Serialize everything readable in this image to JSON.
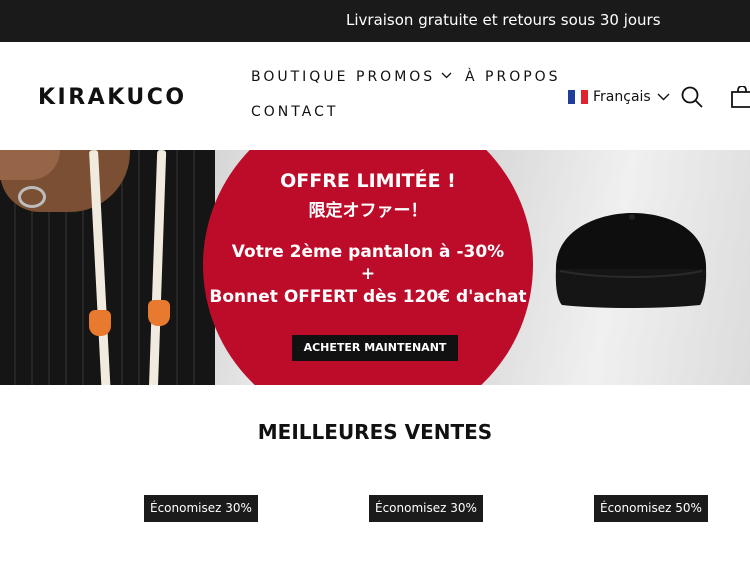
{
  "announcement": "Livraison gratuite et retours sous 30 jours",
  "header": {
    "logo": "KIRAKUCO",
    "nav": {
      "boutique": "BOUTIQUE",
      "promos": "PROMOS",
      "apropos": "À PROPOS",
      "contact": "CONTACT"
    },
    "language": "Français"
  },
  "hero": {
    "line1": "OFFRE LIMITÉE !",
    "line2": "限定オファー！",
    "line3": "Votre 2ème pantalon à -30%",
    "line4": "+",
    "line5": "Bonnet OFFERT dès 120€ d'achat",
    "cta": "ACHETER MAINTENANT"
  },
  "bestsellers": {
    "title": "MEILLEURES VENTES",
    "products": [
      {
        "badge": "Économisez 30%"
      },
      {
        "badge": "Économisez 30%"
      },
      {
        "badge": "Économisez 50%"
      }
    ]
  },
  "colors": {
    "announcement_bg": "#1a1a1a",
    "hero_circle": "#bd0c2a",
    "badge_bg": "#1b1b1b"
  },
  "icons": {
    "promos_dropdown": "chevron-down-icon",
    "language_dropdown": "chevron-down-icon",
    "flag": "france-flag-icon",
    "search": "search-icon",
    "cart": "cart-icon"
  }
}
